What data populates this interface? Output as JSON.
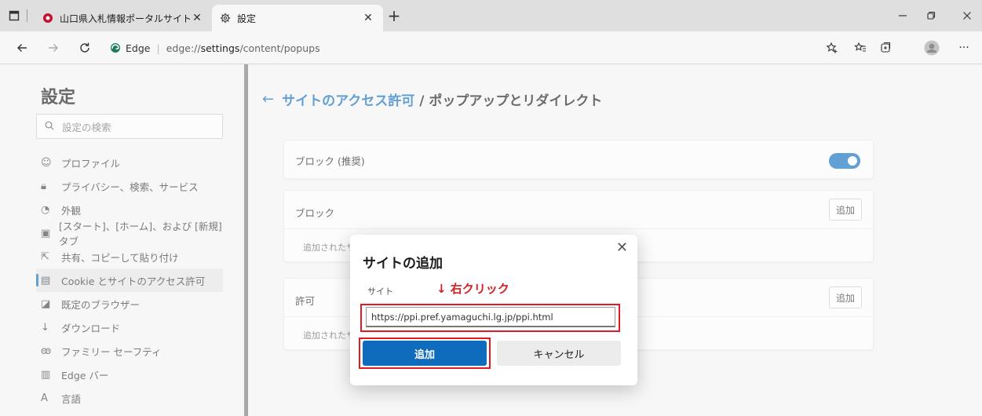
{
  "tabs": [
    {
      "title": "山口県入札情報ポータルサイト-トッ",
      "active": false
    },
    {
      "title": "設定",
      "active": true
    }
  ],
  "new_tab_label": "+",
  "address": {
    "label": "Edge",
    "url_prefix": "edge://",
    "url_strong": "settings",
    "url_suffix": "/content/popups"
  },
  "sidebar": {
    "title": "設定",
    "search_placeholder": "設定の検索",
    "items": [
      {
        "label": "プロファイル",
        "icon": "profile-icon"
      },
      {
        "label": "プライバシー、検索、サービス",
        "icon": "lock-icon"
      },
      {
        "label": "外観",
        "icon": "appearance-icon"
      },
      {
        "label": "[スタート]、[ホーム]、および [新規] タブ",
        "icon": "start-home-icon"
      },
      {
        "label": "共有、コピーして貼り付け",
        "icon": "share-icon"
      },
      {
        "label": "Cookie とサイトのアクセス許可",
        "icon": "cookie-icon",
        "selected": true
      },
      {
        "label": "既定のブラウザー",
        "icon": "browser-icon"
      },
      {
        "label": "ダウンロード",
        "icon": "download-icon"
      },
      {
        "label": "ファミリー セーフティ",
        "icon": "family-icon"
      },
      {
        "label": "Edge バー",
        "icon": "edge-bar-icon"
      },
      {
        "label": "言語",
        "icon": "language-icon"
      }
    ]
  },
  "breadcrumb": {
    "link": "サイトのアクセス許可",
    "current": "/ ポップアップとリダイレクト"
  },
  "cards": {
    "block_recommended": "ブロック (推奨)",
    "block_title": "ブロック",
    "block_sub": "追加されたサイ",
    "allow_title": "許可",
    "allow_sub": "追加されたサイ",
    "add_label": "追加"
  },
  "dialog": {
    "title": "サイトの追加",
    "site_label": "サイト",
    "annotation": "↓ 右クリック",
    "input_value": "https://ppi.pref.yamaguchi.lg.jp/ppi.html",
    "add_button": "追加",
    "cancel_button": "キャンセル"
  },
  "colors": {
    "accent": "#0f6cbd",
    "annotation_red": "#e01b24"
  }
}
